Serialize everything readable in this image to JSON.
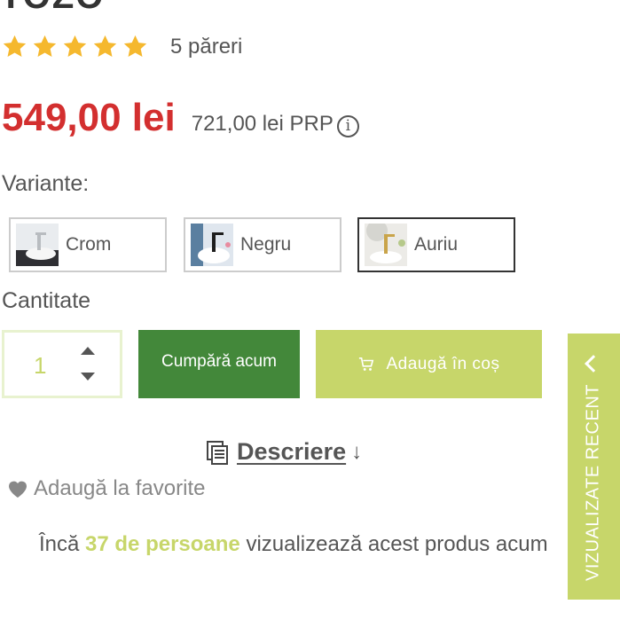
{
  "product": {
    "title_fragment": "TOZO",
    "rating": {
      "stars": 5,
      "max": 5,
      "reviews_label": "5 păreri",
      "star_color": "#f5b82e"
    },
    "price": "549,00 lei",
    "old_price": "721,00 lei PRP",
    "info_icon": "info-icon"
  },
  "variants": {
    "label": "Variante:",
    "options": [
      {
        "label": "Crom",
        "selected": false
      },
      {
        "label": "Negru",
        "selected": false
      },
      {
        "label": "Auriu",
        "selected": true
      }
    ]
  },
  "quantity": {
    "label": "Cantitate",
    "value": "1"
  },
  "actions": {
    "buy_now": "Cumpără acum",
    "add_to_cart": "Adaugă în coș",
    "cart_icon": "cart-icon"
  },
  "recently_viewed": {
    "label": "VIZUALIZATE RECENT",
    "icon": "chevron-left-icon"
  },
  "description": {
    "label": "Descriere",
    "arrow": "↓",
    "icon": "document-icon"
  },
  "favorites": {
    "label": "Adaugă la favorite",
    "icon": "heart-icon"
  },
  "viewers": {
    "prefix": "Încă ",
    "highlight": "37 de persoane",
    "suffix": " vizualizează acest produs acum"
  },
  "colors": {
    "price_red": "#d32f2f",
    "dark_green": "#43883a",
    "lime": "#c7d66a",
    "text": "#555555"
  }
}
